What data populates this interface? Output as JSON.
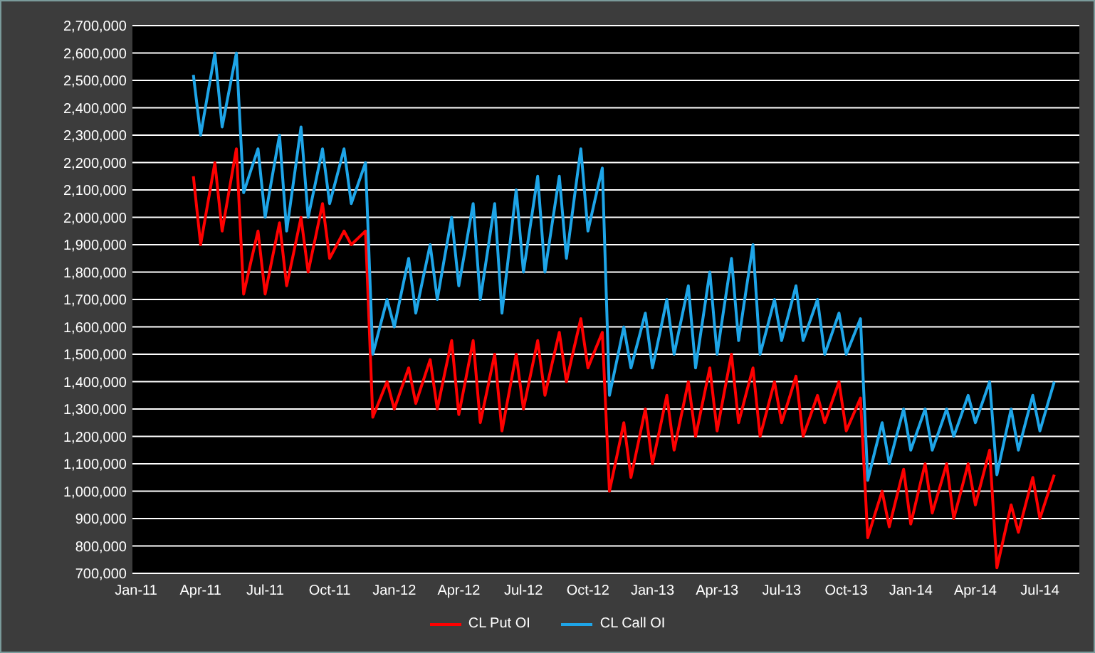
{
  "chart": {
    "chart_data": {
      "type": "line",
      "grid": true,
      "categories": [
        "Jan-11",
        null,
        null,
        null,
        null,
        null,
        null,
        null,
        null,
        "Apr-11",
        null,
        null,
        null,
        null,
        null,
        null,
        null,
        null,
        "Jul-11",
        null,
        null,
        null,
        null,
        null,
        null,
        null,
        null,
        "Oct-11",
        null,
        null,
        null,
        null,
        null,
        null,
        null,
        null,
        "Jan-12",
        null,
        null,
        null,
        null,
        null,
        null,
        null,
        null,
        "Apr-12",
        null,
        null,
        null,
        null,
        null,
        null,
        null,
        null,
        "Jul-12",
        null,
        null,
        null,
        null,
        null,
        null,
        null,
        null,
        "Oct-12",
        null,
        null,
        null,
        null,
        null,
        null,
        null,
        null,
        "Jan-13",
        null,
        null,
        null,
        null,
        null,
        null,
        null,
        null,
        "Apr-13",
        null,
        null,
        null,
        null,
        null,
        null,
        null,
        null,
        "Jul-13",
        null,
        null,
        null,
        null,
        null,
        null,
        null,
        null,
        "Oct-13",
        null,
        null,
        null,
        null,
        null,
        null,
        null,
        null,
        "Jan-14",
        null,
        null,
        null,
        null,
        null,
        null,
        null,
        null,
        "Apr-14",
        null,
        null,
        null,
        null,
        null,
        null,
        null,
        null,
        "Jul-14",
        null,
        null,
        null,
        null,
        null
      ],
      "series": [
        {
          "name": "CL Put OI",
          "color": "#ff0000",
          "values": [
            null,
            null,
            null,
            null,
            null,
            null,
            null,
            null,
            2150000,
            1900000,
            2050000,
            2200000,
            1950000,
            2100000,
            2250000,
            1720000,
            1835000,
            1950000,
            1720000,
            1850000,
            1980000,
            1750000,
            1875000,
            2000000,
            1800000,
            1925000,
            2050000,
            1850000,
            1900000,
            1950000,
            1900000,
            1925000,
            1950000,
            1270000,
            1335000,
            1400000,
            1300000,
            1375000,
            1450000,
            1320000,
            1400000,
            1480000,
            1300000,
            1425000,
            1550000,
            1280000,
            1415000,
            1550000,
            1250000,
            1375000,
            1500000,
            1220000,
            1360000,
            1500000,
            1300000,
            1425000,
            1550000,
            1350000,
            1465000,
            1580000,
            1400000,
            1515000,
            1630000,
            1450000,
            1515000,
            1580000,
            1000000,
            1125000,
            1250000,
            1050000,
            1175000,
            1300000,
            1100000,
            1225000,
            1350000,
            1150000,
            1275000,
            1400000,
            1200000,
            1325000,
            1450000,
            1220000,
            1360000,
            1500000,
            1250000,
            1350000,
            1450000,
            1200000,
            1300000,
            1400000,
            1250000,
            1335000,
            1420000,
            1200000,
            1275000,
            1350000,
            1250000,
            1325000,
            1400000,
            1220000,
            1280000,
            1340000,
            830000,
            915000,
            1000000,
            870000,
            975000,
            1080000,
            880000,
            990000,
            1100000,
            920000,
            1010000,
            1100000,
            900000,
            1000000,
            1100000,
            950000,
            1050000,
            1150000,
            720000,
            835000,
            950000,
            850000,
            950000,
            1050000,
            900000,
            980000,
            1060000,
            null,
            null,
            null
          ]
        },
        {
          "name": "CL Call OI",
          "color": "#1ea5e8",
          "values": [
            null,
            null,
            null,
            null,
            null,
            null,
            null,
            null,
            2520000,
            2300000,
            2450000,
            2600000,
            2330000,
            2465000,
            2600000,
            2090000,
            2170000,
            2250000,
            2000000,
            2150000,
            2300000,
            1950000,
            2140000,
            2330000,
            2000000,
            2125000,
            2250000,
            2050000,
            2150000,
            2250000,
            2050000,
            2125000,
            2200000,
            1500000,
            1600000,
            1700000,
            1600000,
            1725000,
            1850000,
            1650000,
            1775000,
            1900000,
            1700000,
            1850000,
            2000000,
            1750000,
            1900000,
            2050000,
            1700000,
            1875000,
            2050000,
            1650000,
            1875000,
            2100000,
            1800000,
            1975000,
            2150000,
            1800000,
            1975000,
            2150000,
            1850000,
            2050000,
            2250000,
            1950000,
            2065000,
            2180000,
            1350000,
            1475000,
            1600000,
            1450000,
            1550000,
            1650000,
            1450000,
            1575000,
            1700000,
            1500000,
            1625000,
            1750000,
            1450000,
            1625000,
            1800000,
            1500000,
            1675000,
            1850000,
            1550000,
            1725000,
            1900000,
            1500000,
            1600000,
            1700000,
            1550000,
            1650000,
            1750000,
            1550000,
            1625000,
            1700000,
            1500000,
            1575000,
            1650000,
            1500000,
            1565000,
            1630000,
            1040000,
            1145000,
            1250000,
            1100000,
            1200000,
            1300000,
            1150000,
            1225000,
            1300000,
            1150000,
            1225000,
            1300000,
            1200000,
            1275000,
            1350000,
            1250000,
            1325000,
            1400000,
            1060000,
            1180000,
            1300000,
            1150000,
            1250000,
            1350000,
            1220000,
            1310000,
            1400000,
            null,
            null,
            null
          ]
        }
      ],
      "ylim": [
        700000,
        2700000
      ],
      "yticks": [
        {
          "value": 700000,
          "label": "700,000"
        },
        {
          "value": 800000,
          "label": "800,000"
        },
        {
          "value": 900000,
          "label": "900,000"
        },
        {
          "value": 1000000,
          "label": "1,000,000"
        },
        {
          "value": 1100000,
          "label": "1,100,000"
        },
        {
          "value": 1200000,
          "label": "1,200,000"
        },
        {
          "value": 1300000,
          "label": "1,300,000"
        },
        {
          "value": 1400000,
          "label": "1,400,000"
        },
        {
          "value": 1500000,
          "label": "1,500,000"
        },
        {
          "value": 1600000,
          "label": "1,600,000"
        },
        {
          "value": 1700000,
          "label": "1,700,000"
        },
        {
          "value": 1800000,
          "label": "1,800,000"
        },
        {
          "value": 1900000,
          "label": "1,900,000"
        },
        {
          "value": 2000000,
          "label": "2,000,000"
        },
        {
          "value": 2100000,
          "label": "2,100,000"
        },
        {
          "value": 2200000,
          "label": "2,200,000"
        },
        {
          "value": 2300000,
          "label": "2,300,000"
        },
        {
          "value": 2400000,
          "label": "2,400,000"
        },
        {
          "value": 2500000,
          "label": "2,500,000"
        },
        {
          "value": 2600000,
          "label": "2,600,000"
        },
        {
          "value": 2700000,
          "label": "2,700,000"
        }
      ]
    }
  }
}
